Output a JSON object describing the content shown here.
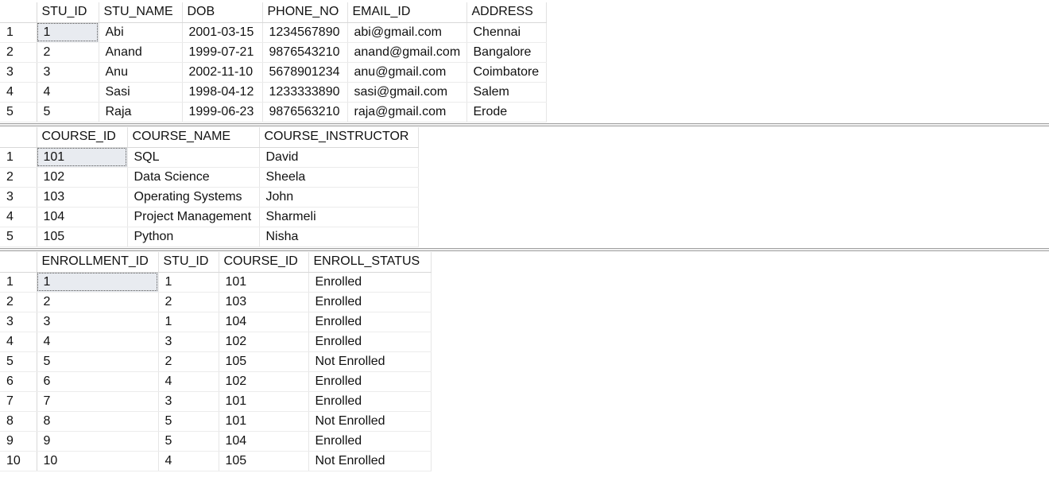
{
  "students": {
    "columns": [
      "STU_ID",
      "STU_NAME",
      "DOB",
      "PHONE_NO",
      "EMAIL_ID",
      "ADDRESS"
    ],
    "rows": [
      [
        "1",
        "Abi",
        "2001-03-15",
        "1234567890",
        "abi@gmail.com",
        "Chennai"
      ],
      [
        "2",
        "Anand",
        "1999-07-21",
        "9876543210",
        "anand@gmail.com",
        "Bangalore"
      ],
      [
        "3",
        "Anu",
        "2002-11-10",
        "5678901234",
        "anu@gmail.com",
        "Coimbatore"
      ],
      [
        "4",
        "Sasi",
        "1998-04-12",
        "1233333890",
        "sasi@gmail.com",
        "Salem"
      ],
      [
        "5",
        "Raja",
        "1999-06-23",
        "9876563210",
        "raja@gmail.com",
        "Erode"
      ]
    ]
  },
  "courses": {
    "columns": [
      "COURSE_ID",
      "COURSE_NAME",
      "COURSE_INSTRUCTOR"
    ],
    "rows": [
      [
        "101",
        "SQL",
        "David"
      ],
      [
        "102",
        "Data Science",
        "Sheela"
      ],
      [
        "103",
        "Operating Systems",
        "John"
      ],
      [
        "104",
        "Project Management",
        "Sharmeli"
      ],
      [
        "105",
        "Python",
        "Nisha"
      ]
    ]
  },
  "enrollments": {
    "columns": [
      "ENROLLMENT_ID",
      "STU_ID",
      "COURSE_ID",
      "ENROLL_STATUS"
    ],
    "rows": [
      [
        "1",
        "1",
        "101",
        "Enrolled"
      ],
      [
        "2",
        "2",
        "103",
        "Enrolled"
      ],
      [
        "3",
        "1",
        "104",
        "Enrolled"
      ],
      [
        "4",
        "3",
        "102",
        "Enrolled"
      ],
      [
        "5",
        "2",
        "105",
        "Not Enrolled"
      ],
      [
        "6",
        "4",
        "102",
        "Enrolled"
      ],
      [
        "7",
        "3",
        "101",
        "Enrolled"
      ],
      [
        "8",
        "5",
        "101",
        "Not Enrolled"
      ],
      [
        "9",
        "5",
        "104",
        "Enrolled"
      ],
      [
        "10",
        "4",
        "105",
        "Not Enrolled"
      ]
    ]
  }
}
